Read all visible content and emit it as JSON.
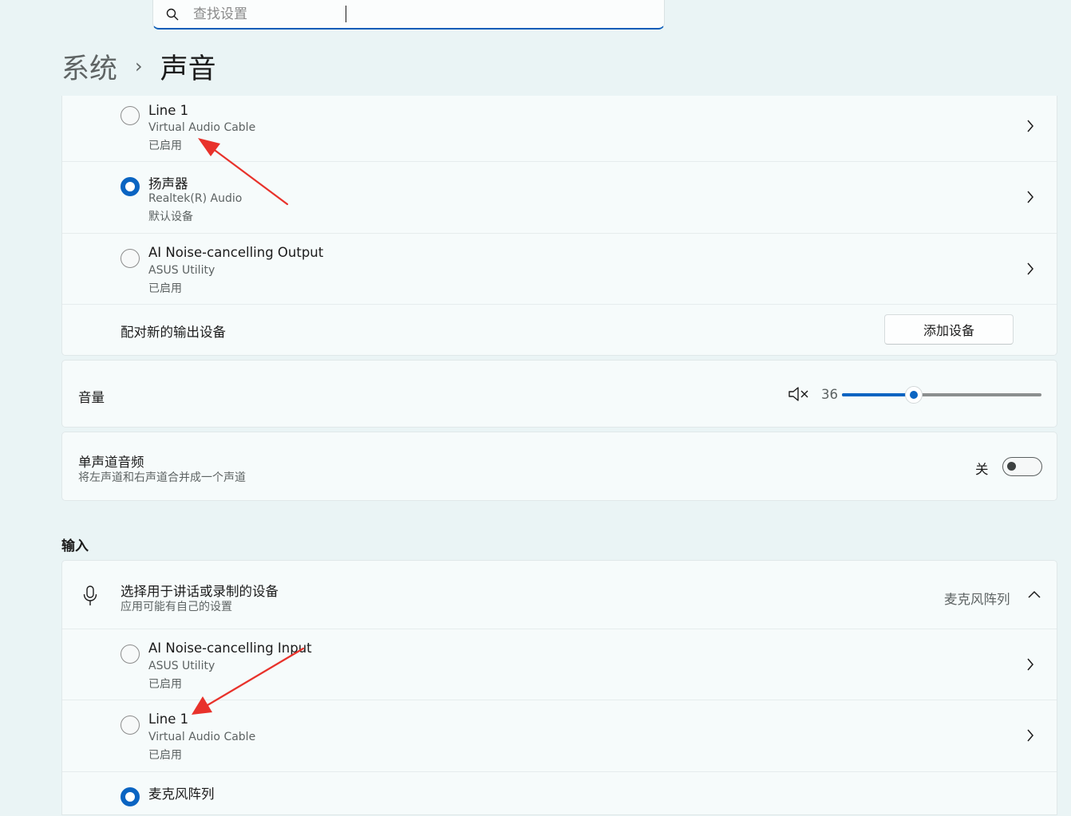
{
  "search": {
    "placeholder": "查找设置"
  },
  "breadcrumb": {
    "parent": "系统",
    "current": "声音"
  },
  "output_devices": [
    {
      "name": "Line 1",
      "driver": "Virtual Audio Cable",
      "status": "已启用",
      "selected": false
    },
    {
      "name": "扬声器",
      "driver": "Realtek(R) Audio",
      "status": "默认设备",
      "selected": true
    },
    {
      "name": "AI Noise-cancelling Output",
      "driver": "ASUS Utility",
      "status": "已启用",
      "selected": false
    }
  ],
  "pair_output": {
    "label": "配对新的输出设备",
    "button": "添加设备"
  },
  "volume": {
    "label": "音量",
    "value": "36",
    "level": 36,
    "icon": "speaker-mute-icon"
  },
  "mono_audio": {
    "title": "单声道音频",
    "description": "将左声道和右声道合并成一个声道",
    "state": "关",
    "on": false
  },
  "input": {
    "section_title": "输入",
    "chooser_title": "选择用于讲话或录制的设备",
    "chooser_subtitle": "应用可能有自己的设置",
    "current_device": "麦克风阵列",
    "devices": [
      {
        "name": "AI Noise-cancelling Input",
        "driver": "ASUS Utility",
        "status": "已启用",
        "selected": false
      },
      {
        "name": "Line 1",
        "driver": "Virtual Audio Cable",
        "status": "已启用",
        "selected": false
      },
      {
        "name": "麦克风阵列",
        "selected": true
      }
    ]
  },
  "colors": {
    "accent": "#0a64c2",
    "annotation": "#e8322b",
    "background": "#eaf4f5"
  }
}
